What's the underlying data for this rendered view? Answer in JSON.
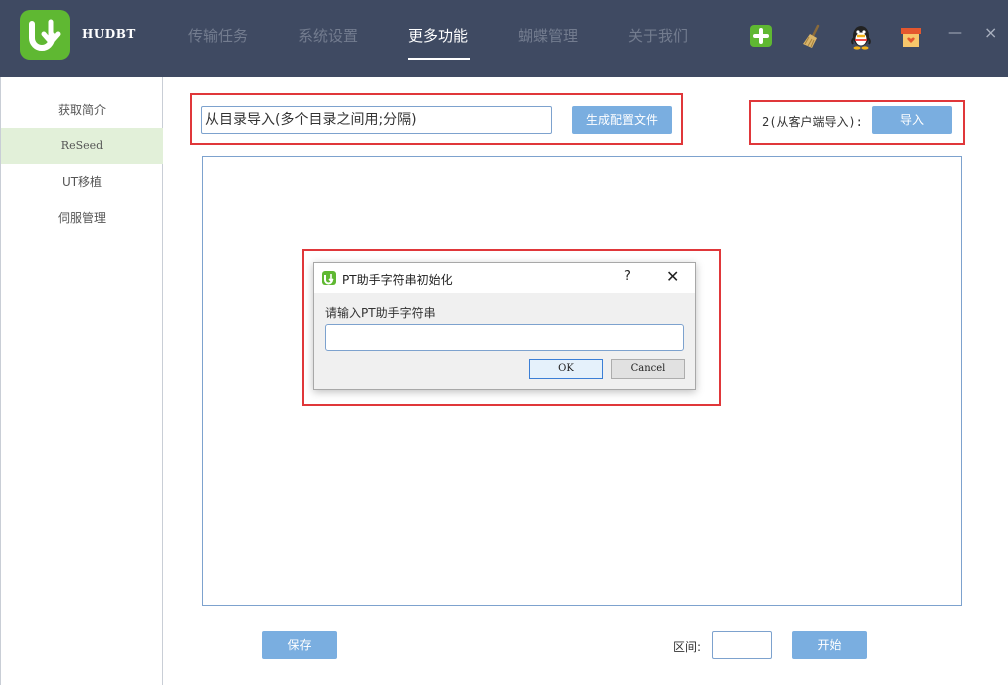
{
  "app": {
    "brand": "HUDBT",
    "nav": [
      {
        "label": "传输任务"
      },
      {
        "label": "系统设置"
      },
      {
        "label": "更多功能"
      },
      {
        "label": "蝴蝶管理"
      },
      {
        "label": "关于我们"
      }
    ],
    "active_tab": "更多功能",
    "header_icons": [
      "add-icon",
      "broom-icon",
      "qq-penguin-icon",
      "gift-box-icon"
    ],
    "window_controls": {
      "minimize": "—",
      "close": "×"
    }
  },
  "sidebar": {
    "items": [
      {
        "label": "获取简介"
      },
      {
        "label": "ReSeed"
      },
      {
        "label": "UT移植"
      },
      {
        "label": "伺服管理"
      }
    ],
    "active": "ReSeed"
  },
  "main": {
    "path_input_value": "从目录导入(多个目录之间用;分隔)",
    "generate_button": "生成配置文件",
    "client_import_label": "2(从客户端导入):",
    "import_button": "导入",
    "save_button": "保存",
    "range_label": "区间:",
    "range_value": "",
    "start_button": "开始"
  },
  "dialog": {
    "title": "PT助手字符串初始化",
    "help": "?",
    "close": "✕",
    "prompt": "请输入PT助手字符串",
    "input_value": "",
    "ok_button": "OK",
    "cancel_button": "Cancel"
  },
  "colors": {
    "header_bg": "#3f4a62",
    "accent_green": "#5fb832",
    "button_blue": "#7aaee0",
    "highlight_red": "#e0373a",
    "sidebar_active": "#e2f0d9"
  }
}
